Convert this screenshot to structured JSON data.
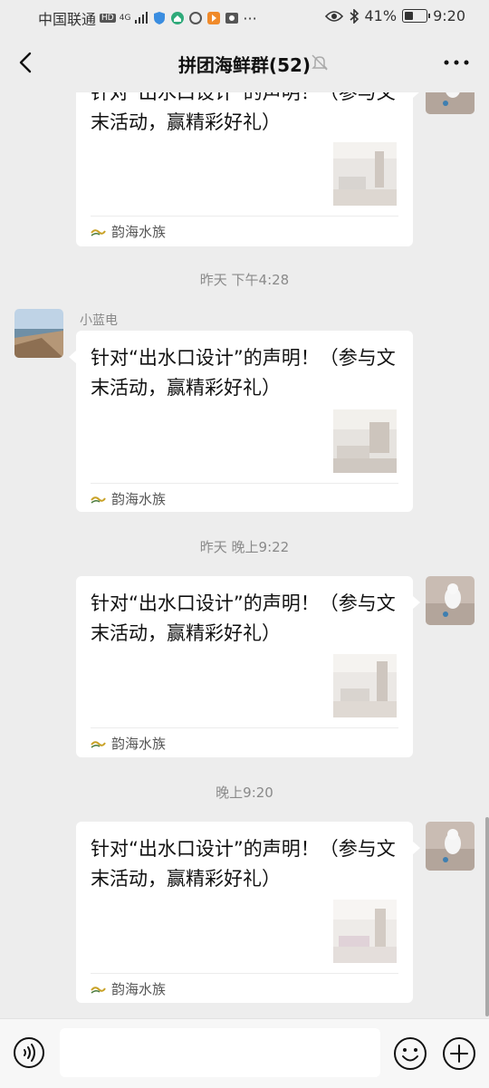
{
  "status_bar": {
    "carrier": "中国联通",
    "network_badges": [
      "HD",
      "4G"
    ],
    "battery_percent": "41%",
    "battery_level": 0.41,
    "time": "9:20"
  },
  "header": {
    "title": "拼团海鲜群(52)",
    "muted": true
  },
  "messages": [
    {
      "kind": "card",
      "side": "right",
      "text": "针对“出水口设计”的声明！（参与文末活动，赢精彩好礼）",
      "source": "韵海水族"
    },
    {
      "kind": "time",
      "text": "昨天 下午4:28"
    },
    {
      "kind": "card",
      "side": "left",
      "sender": "小蓝电",
      "text": "针对“出水口设计”的声明！（参与文末活动，赢精彩好礼）",
      "source": "韵海水族"
    },
    {
      "kind": "time",
      "text": "昨天 晚上9:22"
    },
    {
      "kind": "card",
      "side": "right",
      "text": "针对“出水口设计”的声明！（参与文末活动，赢精彩好礼）",
      "source": "韵海水族"
    },
    {
      "kind": "time",
      "text": "晚上9:20"
    },
    {
      "kind": "card",
      "side": "right",
      "text": "针对“出水口设计”的声明！（参与文末活动，赢精彩好礼）",
      "source": "韵海水族"
    }
  ],
  "input_bar": {
    "placeholder": "",
    "icons": [
      "voice-icon",
      "emoji-icon",
      "plus-icon"
    ]
  },
  "colors": {
    "background": "#ededed",
    "bubble": "#ffffff",
    "timestamp": "#8a8a8a"
  }
}
